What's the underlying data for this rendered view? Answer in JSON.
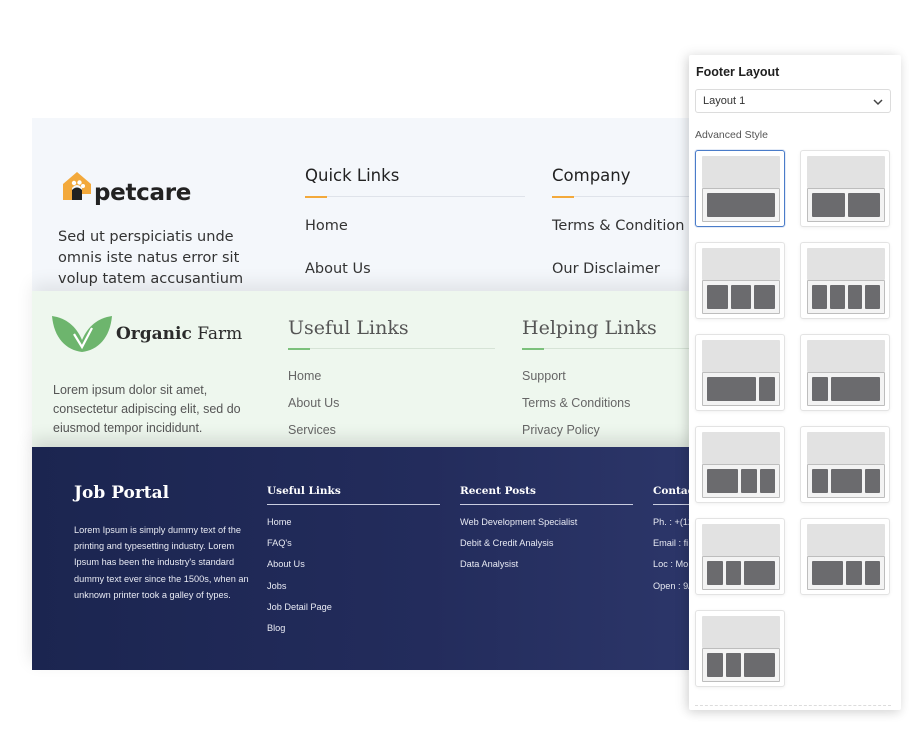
{
  "petcare": {
    "logo_text": "petcare",
    "description": "Sed ut perspiciatis unde omnis iste natus error sit volup tatem accusantium",
    "columns": [
      {
        "title": "Quick Links",
        "links": [
          "Home",
          "About Us"
        ]
      },
      {
        "title": "Company",
        "links": [
          "Terms & Condition",
          "Our Disclaimer"
        ]
      }
    ],
    "accent_color": "#f3a93b"
  },
  "farm": {
    "logo_text_bold": "Organic",
    "logo_text_rest": " Farm",
    "description": "Lorem ipsum dolor sit amet, consectetur adipiscing elit, sed do eiusmod tempor incididunt.",
    "columns": [
      {
        "title": "Useful Links",
        "links": [
          "Home",
          "About Us",
          "Services"
        ]
      },
      {
        "title": "Helping Links",
        "links": [
          "Support",
          "Terms & Conditions",
          "Privacy Policy"
        ]
      }
    ],
    "accent_color": "#7cc17c"
  },
  "job": {
    "title": "Job Portal",
    "description": "Lorem Ipsum is simply dummy text of the printing and typesetting industry. Lorem Ipsum has been the industry's standard dummy text ever since the 1500s, when an unknown printer took a galley of types.",
    "columns": [
      {
        "title": "Useful Links",
        "links": [
          "Home",
          "FAQ's",
          "About Us",
          "Jobs",
          "Job Detail Page",
          "Blog"
        ]
      },
      {
        "title": "Recent Posts",
        "links": [
          "Web Development Specialist",
          "Debit & Credit Analysis",
          "Data Analysist"
        ]
      },
      {
        "title": "Contac",
        "links": [
          "Ph. : +(12",
          "Email : fi",
          "Loc : Mo",
          "Open : 9/"
        ]
      }
    ],
    "background_color": "#1b2550"
  },
  "panel": {
    "title": "Footer Layout",
    "select_value": "Layout 1",
    "advanced_label": "Advanced Style",
    "selected_index": 0,
    "layout_options": [
      {
        "columns": [
          1
        ]
      },
      {
        "columns": [
          1,
          1
        ]
      },
      {
        "columns": [
          1,
          1,
          1
        ]
      },
      {
        "columns": [
          1,
          1,
          1,
          1
        ]
      },
      {
        "columns": [
          3,
          1
        ]
      },
      {
        "columns": [
          1,
          3
        ]
      },
      {
        "columns": [
          2,
          1,
          1
        ]
      },
      {
        "columns": [
          1,
          2,
          1
        ]
      },
      {
        "columns": [
          1,
          1,
          2
        ]
      },
      {
        "columns": [
          2,
          1,
          1
        ]
      },
      {
        "columns": [
          1,
          1,
          2
        ]
      }
    ],
    "accent_color": "#4a7cc9"
  }
}
